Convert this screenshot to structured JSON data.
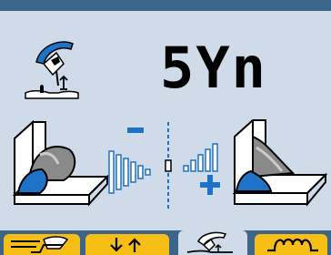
{
  "display": {
    "mode_text": "5Yn"
  },
  "adjustment": {
    "minus_symbol": "minus",
    "plus_symbol": "plus",
    "bar_levels": [
      1,
      2,
      3,
      4,
      5,
      6,
      7,
      8,
      9,
      10,
      11
    ],
    "selected_level": 6
  },
  "icons": {
    "header": "torch-pulse-icon",
    "left_weld": "weld-convex-bead-icon",
    "right_weld": "weld-concave-bead-icon"
  },
  "tabs": [
    {
      "name": "tab-wire-feed",
      "icon": "wire-feed-icon",
      "active": false
    },
    {
      "name": "tab-trigger-mode",
      "icon": "trigger-mode-icon",
      "active": false
    },
    {
      "name": "tab-synergic",
      "icon": "torch-icon",
      "active": true
    },
    {
      "name": "tab-inductance",
      "icon": "inductance-icon",
      "active": false
    }
  ],
  "colors": {
    "panel_background": "#cfdbe8",
    "frame": "#3d6489",
    "accent_blue": "#1e72c7",
    "tab_yellow": "#f7bf16"
  }
}
